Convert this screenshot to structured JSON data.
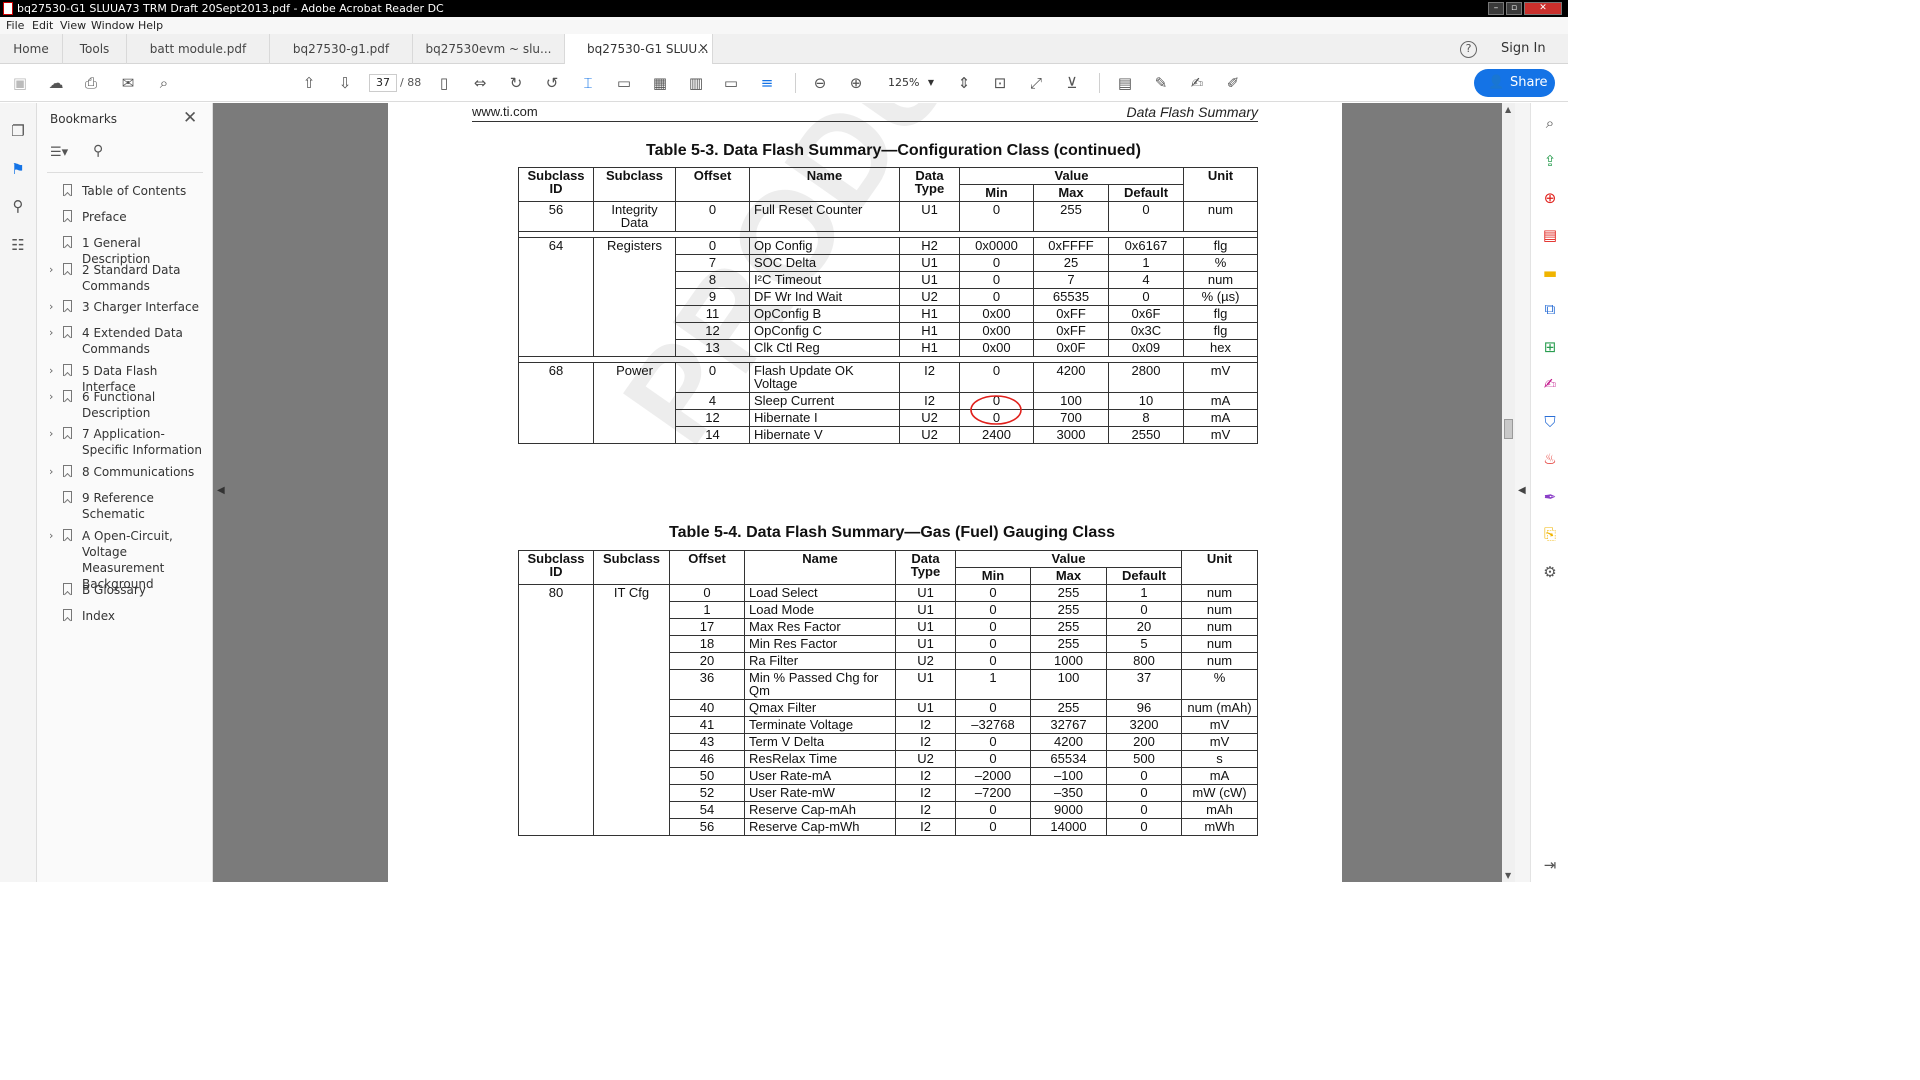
{
  "window": {
    "title": "bq27530-G1 SLUUA73 TRM Draft 20Sept2013.pdf - Adobe Acrobat Reader DC"
  },
  "menu": [
    "File",
    "Edit",
    "View",
    "Window",
    "Help"
  ],
  "tabs": {
    "home": "Home",
    "tools": "Tools",
    "docs": [
      "batt module.pdf",
      "bq27530-g1.pdf",
      "bq27530evm ~ slu...",
      "bq27530-G1 SLUU..."
    ],
    "close": "×",
    "signin": "Sign In",
    "help": "?"
  },
  "toolbar": {
    "page_current": "37",
    "page_total": "/ 88",
    "zoom": "125%",
    "share": "Share"
  },
  "bookmarks": {
    "title": "Bookmarks",
    "items": [
      "Table of Contents",
      "Preface",
      "1  General Description",
      "2  Standard Data Commands",
      "3  Charger Interface",
      "4  Extended Data Commands",
      "5  Data Flash Interface",
      "6  Functional Description",
      "7  Application-Specific Information",
      "8  Communications",
      "9  Reference Schematic",
      "A  Open-Circuit, Voltage Measurement Background",
      "B  Glossary",
      "Index"
    ]
  },
  "doc": {
    "header_left": "www.ti.com",
    "header_right": "Data Flash Summary",
    "watermark": "PRODUCT PREVIEW ONLY",
    "table1": {
      "title": "Table 5-3. Data Flash Summary—Configuration Class (continued)",
      "headers": {
        "subclass_id": "Subclass ID",
        "subclass": "Subclass",
        "offset": "Offset",
        "name": "Name",
        "data_type": "Data Type",
        "value": "Value",
        "min": "Min",
        "max": "Max",
        "default": "Default",
        "unit": "Unit"
      },
      "rows": [
        [
          "56",
          "Integrity Data",
          "0",
          "Full Reset Counter",
          "U1",
          "0",
          "255",
          "0",
          "num"
        ],
        [
          "64",
          "Registers",
          "0",
          "Op Config",
          "H2",
          "0x0000",
          "0xFFFF",
          "0x6167",
          "flg"
        ],
        [
          "",
          "",
          "7",
          "SOC Delta",
          "U1",
          "0",
          "25",
          "1",
          "%"
        ],
        [
          "",
          "",
          "8",
          "I²C Timeout",
          "U1",
          "0",
          "7",
          "4",
          "num"
        ],
        [
          "",
          "",
          "9",
          "DF Wr Ind Wait",
          "U2",
          "0",
          "65535",
          "0",
          "% (µs)"
        ],
        [
          "",
          "",
          "11",
          "OpConfig B",
          "H1",
          "0x00",
          "0xFF",
          "0x6F",
          "flg"
        ],
        [
          "",
          "",
          "12",
          "OpConfig C",
          "H1",
          "0x00",
          "0xFF",
          "0x3C",
          "flg"
        ],
        [
          "",
          "",
          "13",
          "Clk Ctl Reg",
          "H1",
          "0x00",
          "0x0F",
          "0x09",
          "hex"
        ],
        [
          "68",
          "Power",
          "0",
          "Flash Update OK Voltage",
          "I2",
          "0",
          "4200",
          "2800",
          "mV"
        ],
        [
          "",
          "",
          "4",
          "Sleep Current",
          "I2",
          "0",
          "100",
          "10",
          "mA"
        ],
        [
          "",
          "",
          "12",
          "Hibernate I",
          "U2",
          "0",
          "700",
          "8",
          "mA"
        ],
        [
          "",
          "",
          "14",
          "Hibernate V",
          "U2",
          "2400",
          "3000",
          "2550",
          "mV"
        ]
      ]
    },
    "table2": {
      "title": "Table 5-4. Data Flash Summary—Gas (Fuel) Gauging Class",
      "rows": [
        [
          "80",
          "IT Cfg",
          "0",
          "Load Select",
          "U1",
          "0",
          "255",
          "1",
          "num"
        ],
        [
          "",
          "",
          "1",
          "Load Mode",
          "U1",
          "0",
          "255",
          "0",
          "num"
        ],
        [
          "",
          "",
          "17",
          "Max Res Factor",
          "U1",
          "0",
          "255",
          "20",
          "num"
        ],
        [
          "",
          "",
          "18",
          "Min Res Factor",
          "U1",
          "0",
          "255",
          "5",
          "num"
        ],
        [
          "",
          "",
          "20",
          "Ra Filter",
          "U2",
          "0",
          "1000",
          "800",
          "num"
        ],
        [
          "",
          "",
          "36",
          "Min % Passed Chg for Qm",
          "U1",
          "1",
          "100",
          "37",
          "%"
        ],
        [
          "",
          "",
          "40",
          "Qmax Filter",
          "U1",
          "0",
          "255",
          "96",
          "num (mAh)"
        ],
        [
          "",
          "",
          "41",
          "Terminate Voltage",
          "I2",
          "–32768",
          "32767",
          "3200",
          "mV"
        ],
        [
          "",
          "",
          "43",
          "Term V Delta",
          "I2",
          "0",
          "4200",
          "200",
          "mV"
        ],
        [
          "",
          "",
          "46",
          "ResRelax Time",
          "U2",
          "0",
          "65534",
          "500",
          "s"
        ],
        [
          "",
          "",
          "50",
          "User Rate-mA",
          "I2",
          "–2000",
          "–100",
          "0",
          "mA"
        ],
        [
          "",
          "",
          "52",
          "User Rate-mW",
          "I2",
          "–7200",
          "–350",
          "0",
          "mW (cW)"
        ],
        [
          "",
          "",
          "54",
          "Reserve Cap-mAh",
          "I2",
          "0",
          "9000",
          "0",
          "mAh"
        ],
        [
          "",
          "",
          "56",
          "Reserve Cap-mWh",
          "I2",
          "0",
          "14000",
          "0",
          "mWh"
        ]
      ]
    }
  },
  "colors": {
    "accent": "#1473e6",
    "annotation": "#e0201b"
  }
}
